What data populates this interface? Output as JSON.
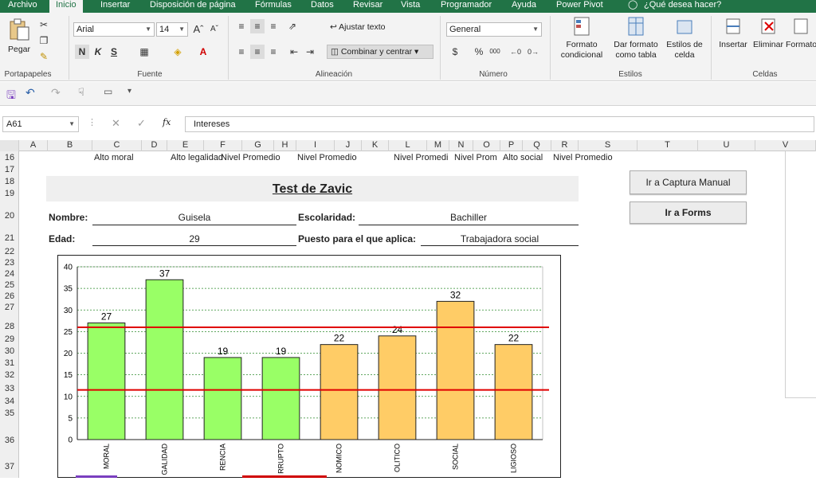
{
  "menu": {
    "tabs": [
      "Archivo",
      "Inicio",
      "Insertar",
      "Disposición de página",
      "Fórmulas",
      "Datos",
      "Revisar",
      "Vista",
      "Programador",
      "Ayuda",
      "Power Pivot"
    ],
    "tell_me": "¿Qué desea hacer?"
  },
  "ribbon": {
    "clipboard": {
      "paste": "Pegar",
      "group": "Portapapeles"
    },
    "font": {
      "name": "Arial",
      "size": "14",
      "bold": "N",
      "italic": "K",
      "underline": "S",
      "group": "Fuente"
    },
    "alignment": {
      "wrap": "Ajustar texto",
      "merge": "Combinar y centrar",
      "group": "Alineación"
    },
    "number": {
      "format": "General",
      "currency": "$",
      "percent": "%",
      "thousands": "000",
      "group": "Número"
    },
    "styles": {
      "conditional": "Formato condicional",
      "as_table": "Dar formato como tabla",
      "cell_styles": "Estilos de celda",
      "group": "Estilos"
    },
    "cells": {
      "insert": "Insertar",
      "delete": "Eliminar",
      "format": "Formato",
      "group": "Celdas"
    }
  },
  "formula_bar": {
    "name_box": "A61",
    "content": "Intereses",
    "fx": "fx"
  },
  "columns": [
    "A",
    "B",
    "C",
    "D",
    "E",
    "F",
    "G",
    "H",
    "I",
    "J",
    "K",
    "L",
    "M",
    "N",
    "O",
    "P",
    "Q",
    "R",
    "S",
    "T",
    "U",
    "V"
  ],
  "rows": [
    "16",
    "17",
    "18",
    "19",
    "20",
    "21",
    "22",
    "23",
    "24",
    "25",
    "26",
    "27",
    "28",
    "29",
    "30",
    "31",
    "32",
    "33",
    "34",
    "35",
    "36",
    "37"
  ],
  "row16": [
    "Alto moral",
    "Alto legalidad",
    "Nivel Promedio",
    "Nivel Promedio",
    "Nivel Promedi",
    "Nivel Prom",
    "Alto social",
    "Nivel Promedio"
  ],
  "sheet": {
    "title": "Test de Zavic",
    "name_label": "Nombre:",
    "name_value": "Guisela",
    "school_label": "Escolaridad:",
    "school_value": "Bachiller",
    "age_label": "Edad:",
    "age_value": "29",
    "job_label": "Puesto para el que aplica:",
    "job_value": "Trabajadora social"
  },
  "buttons": {
    "manual": "Ir a Captura Manual",
    "forms": "Ir a Forms"
  },
  "colors": {
    "excel_green": "#217346",
    "bar_green": "#99ff66",
    "bar_orange": "#ffcc66",
    "threshold": "#e00000",
    "grid": "#2e8b2e"
  },
  "chart_data": {
    "type": "bar",
    "categories": [
      "MORAL",
      "LEGALIDAD",
      "INDIFERENCIA",
      "CORRUPTO",
      "ECONOMICO",
      "POLITICO",
      "SOCIAL",
      "RELIGIOSO"
    ],
    "visible_tick_labels": [
      "MORAL",
      "GALIDAD",
      "RENCIA",
      "RRUPTO",
      "NOMICO",
      "OLITICO",
      "SOCIAL",
      "LIGIOSO"
    ],
    "values": [
      27,
      37,
      19,
      19,
      22,
      24,
      32,
      22
    ],
    "colors": [
      "#99ff66",
      "#99ff66",
      "#99ff66",
      "#99ff66",
      "#ffcc66",
      "#ffcc66",
      "#ffcc66",
      "#ffcc66"
    ],
    "thresholds": [
      26,
      11.5
    ],
    "ylim": [
      0,
      40
    ],
    "yticks": [
      0,
      5,
      10,
      15,
      20,
      25,
      30,
      35,
      40
    ],
    "title": "",
    "xlabel": "",
    "ylabel": "",
    "grid": true
  }
}
